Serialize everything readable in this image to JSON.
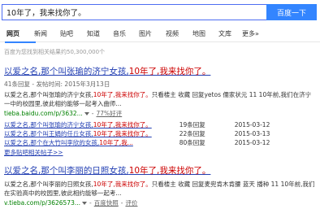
{
  "search": {
    "query": "10年了，我来找你了。",
    "button_label": "百度一下"
  },
  "tabs": [
    {
      "label": "网页",
      "active": true
    },
    {
      "label": "新闻"
    },
    {
      "label": "贴吧"
    },
    {
      "label": "知道"
    },
    {
      "label": "音乐"
    },
    {
      "label": "图片"
    },
    {
      "label": "视频"
    },
    {
      "label": "地图"
    },
    {
      "label": "文库"
    },
    {
      "label": "更多»"
    }
  ],
  "result_count": "百度为您找到相关结果约50,300,000个",
  "results": [
    {
      "title_pre": "以爱之名,那个叫张瑜的济宁女孩,",
      "title_hl": "10年了,我来找你了。",
      "meta": "41条回复 - 发帖时间: 2015年3月13日",
      "abstract_pre": "以爱之名,那个叫张瑜的济宁女孩,",
      "abstract_hl": "10年了,我来找你了。",
      "abstract_post": "只看楼主 收藏 回复yetos 儒家状元 11 10年前,我们在济宁一中的校园里,彼此相约能够一起考入曲师...",
      "url": "tieba.baidu.com/p/3632...",
      "snapshot": "77%好评",
      "threads": [
        {
          "title_pre": "以爱之名,那个叫张瑜的济宁女孩,",
          "title_hl": "10年了,我来找你了。",
          "replies": "19条回复",
          "date": "2015-03-12"
        },
        {
          "title_pre": "以爱之名,那个叫王娟的任丘女孩,",
          "title_hl": "10年了,我来找你了。",
          "replies": "22条回复",
          "date": "2015-03-13"
        },
        {
          "title_pre": "以爱之名,那个在大竹叫李欣的女孩,",
          "title_hl": "10年了,我...",
          "replies": "80条回复",
          "date": "2015-03-12"
        }
      ],
      "more": "更多贴吧相关帖子>>"
    },
    {
      "title_pre": "以爱之名,那个叫李丽的日照女孩,",
      "title_hl": "10年了,我来找你了。",
      "abstract_pre": "以爱之名,那个叫李丽的日照女孩,",
      "abstract_hl": "10年了,我来找你了。",
      "abstract_post": "只看楼主 收藏 回复麦兜肯木肯腰 蓝天 播种 11 10年前,我们在实验高中的校园里,彼此相约能够一起考...",
      "url": "v.tieba.com/p/3626573...",
      "snapshot": "百度快照",
      "evaluate": "评价"
    }
  ]
}
